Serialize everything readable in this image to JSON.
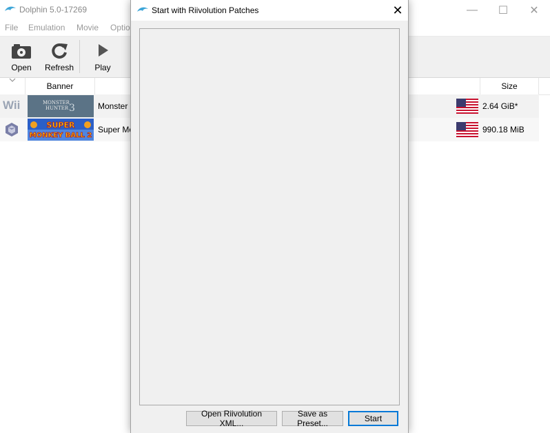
{
  "main_window": {
    "title": "Dolphin 5.0-17269",
    "controls": {
      "minimize": "—",
      "maximize": "☐",
      "close": "✕"
    },
    "menu": [
      "File",
      "Emulation",
      "Movie",
      "Optio"
    ],
    "toolbar": {
      "open": "Open",
      "refresh": "Refresh",
      "play": "Play"
    },
    "columns": {
      "banner": "Banner",
      "size": "Size"
    },
    "games": [
      {
        "platform": "Wii",
        "title": "Monster",
        "size": "2.64 GiB*",
        "banner_line1": "MONSTER",
        "banner_line2": "HUNTER",
        "banner_number": "3"
      },
      {
        "platform": "GameCube",
        "title": "Super Mo",
        "size": "990.18 MiB",
        "banner_line1": "SUPER",
        "banner_line2": "MONKEY BALL 2"
      }
    ]
  },
  "dialog": {
    "title": "Start with Riivolution Patches",
    "close_icon": "✕",
    "buttons": {
      "open_xml": "Open Riivolution XML...",
      "save_preset": "Save as Preset...",
      "start": "Start"
    }
  },
  "colors": {
    "accent": "#0078d7",
    "dolphin": "#3ea6d8"
  }
}
